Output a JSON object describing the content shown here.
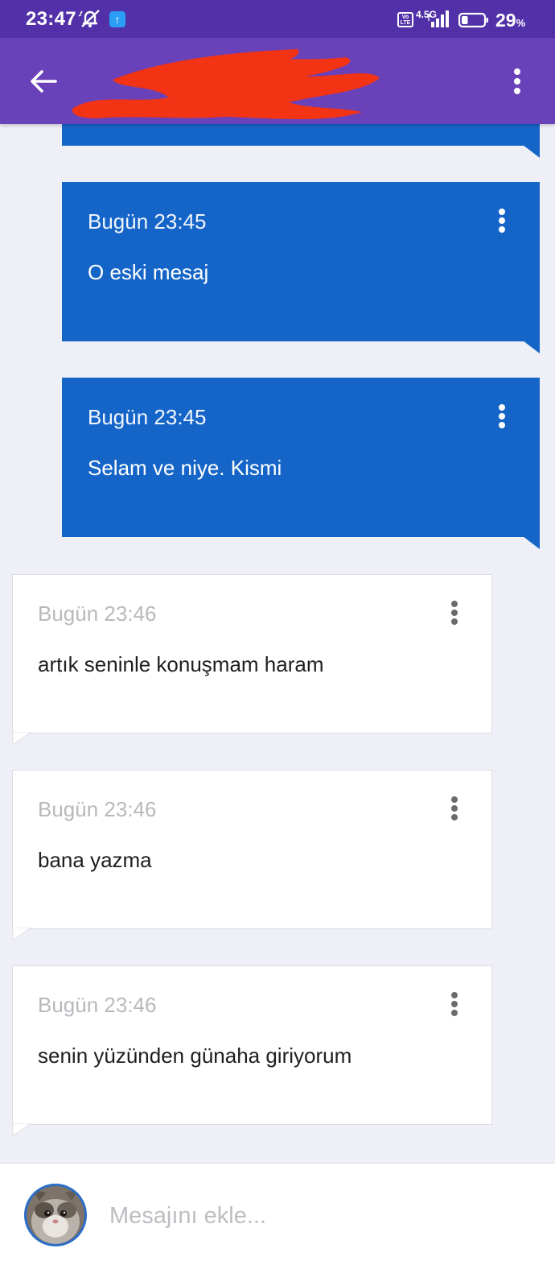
{
  "status_bar": {
    "time": "23:47",
    "network": "4.5G",
    "volte": "Vo LTE",
    "battery_percent": "29",
    "battery_unit": "%",
    "battery_level": 0.29,
    "upload_icon": "upload-arrow-icon",
    "mute_icon": "notifications-off-icon"
  },
  "app_bar": {
    "title_redacted": true,
    "back_icon": "arrow-left-icon",
    "overflow_icon": "more-vert-icon"
  },
  "messages": [
    {
      "direction": "sent",
      "time": "",
      "text": "",
      "partial": true
    },
    {
      "direction": "sent",
      "time": "Bugün 23:45",
      "text": "O eski mesaj"
    },
    {
      "direction": "sent",
      "time": "Bugün 23:45",
      "text": "Selam ve niye. Kismi"
    },
    {
      "direction": "received",
      "time": "Bugün 23:46",
      "text": "artık seninle konuşmam haram"
    },
    {
      "direction": "received",
      "time": "Bugün 23:46",
      "text": "bana yazma"
    },
    {
      "direction": "received",
      "time": "Bugün 23:46",
      "text": "senin yüzünden günaha giriyorum"
    }
  ],
  "composer": {
    "placeholder": "Mesajını ekle...",
    "value": ""
  },
  "colors": {
    "status_bar": "#5231a8",
    "app_bar": "#6942b9",
    "sent_bubble": "#1565c8",
    "received_bubble": "#ffffff",
    "background": "#eff0f7"
  }
}
